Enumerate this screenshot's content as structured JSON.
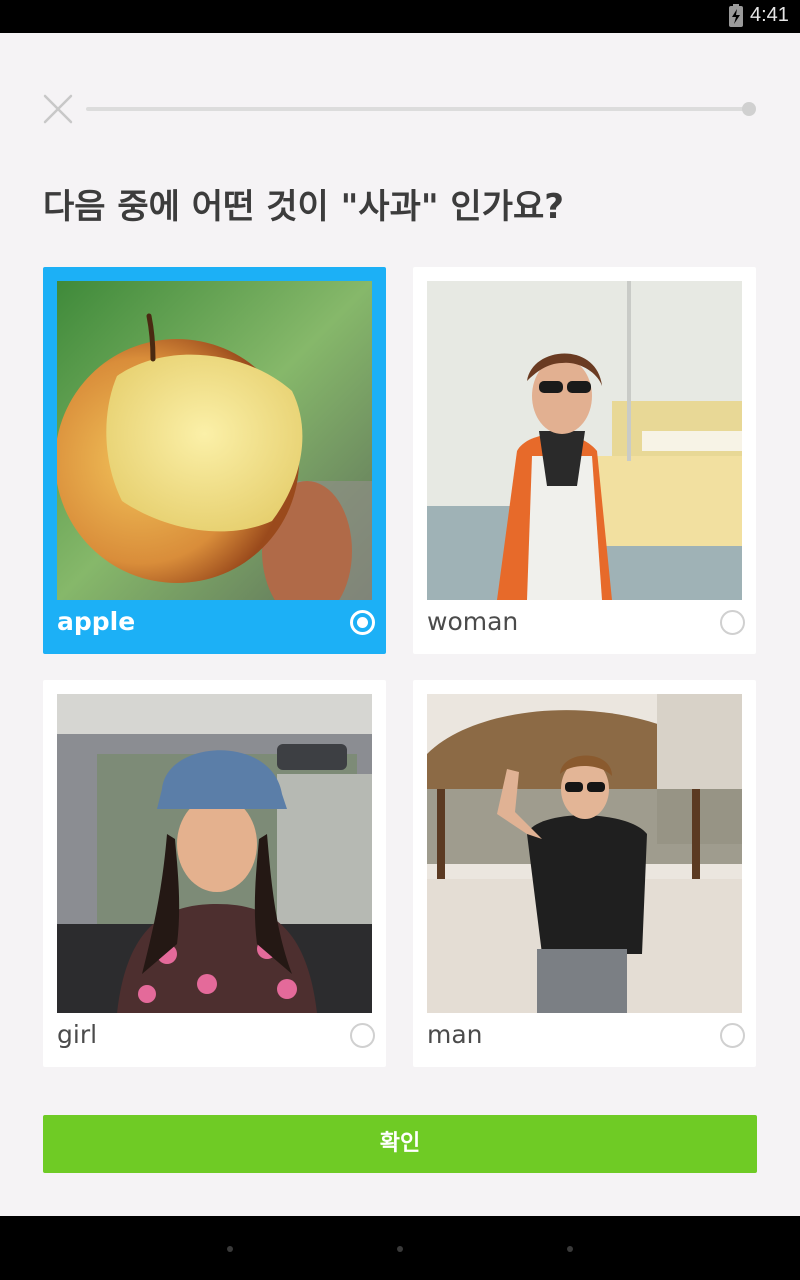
{
  "status_bar": {
    "time": "4:41",
    "battery_icon": "battery-charging-icon"
  },
  "header": {
    "close_icon": "close-icon",
    "progress_fraction": 0.0
  },
  "prompt": {
    "text": "다음 중에 어떤 것이 \"사과\" 인가요?"
  },
  "options": [
    {
      "label": "apple",
      "image": "apple-photo",
      "selected": true
    },
    {
      "label": "woman",
      "image": "woman-photo",
      "selected": false
    },
    {
      "label": "girl",
      "image": "girl-photo",
      "selected": false
    },
    {
      "label": "man",
      "image": "man-photo",
      "selected": false
    }
  ],
  "check_button": {
    "label": "확인"
  },
  "nav_bar": {
    "icons": [
      "nav-back-icon",
      "nav-home-icon",
      "nav-recents-icon"
    ]
  },
  "colors": {
    "selected": "#1cb0f6",
    "check_button": "#6fcb25",
    "background": "#f5f3f5"
  }
}
